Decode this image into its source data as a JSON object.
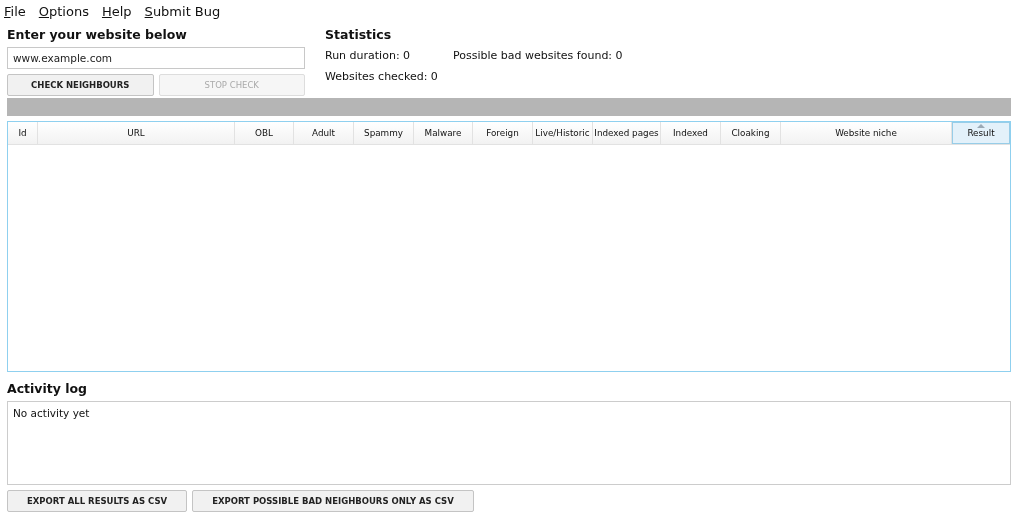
{
  "menu": [
    {
      "label": "File"
    },
    {
      "label": "Options"
    },
    {
      "label": "Help"
    },
    {
      "label": "Submit Bug"
    }
  ],
  "input_section": {
    "title": "Enter your website below",
    "website_field": {
      "value": "www.example.com"
    },
    "buttons": [
      {
        "label": "CHECK NEIGHBOURS",
        "disabled": false
      },
      {
        "label": "STOP CHECK",
        "disabled": true
      }
    ]
  },
  "statistics": {
    "title": "Statistics",
    "items": [
      {
        "text": "Run duration: 0"
      },
      {
        "text": "Possible bad websites found: 0"
      },
      {
        "text": "Websites checked: 0"
      }
    ]
  },
  "progress": {
    "level": 0
  },
  "table": {
    "columns": [
      {
        "label": "Id",
        "sorted": false
      },
      {
        "label": "URL",
        "sorted": false
      },
      {
        "label": "OBL",
        "sorted": false
      },
      {
        "label": "Adult",
        "sorted": false
      },
      {
        "label": "Spammy",
        "sorted": false
      },
      {
        "label": "Malware",
        "sorted": false
      },
      {
        "label": "Foreign",
        "sorted": false
      },
      {
        "label": "Live/Historic",
        "sorted": false
      },
      {
        "label": "Indexed pages",
        "sorted": false
      },
      {
        "label": "Indexed",
        "sorted": false
      },
      {
        "label": "Cloaking",
        "sorted": false
      },
      {
        "label": "Website niche",
        "sorted": false
      },
      {
        "label": "Result",
        "sorted": true
      }
    ]
  },
  "activity_log": {
    "title": "Activity log",
    "text": "No activity yet"
  },
  "export_buttons": [
    "EXPORT ALL RESULTS AS CSV",
    "EXPORT POSSIBLE BAD NEIGHBOURS ONLY AS CSV"
  ]
}
